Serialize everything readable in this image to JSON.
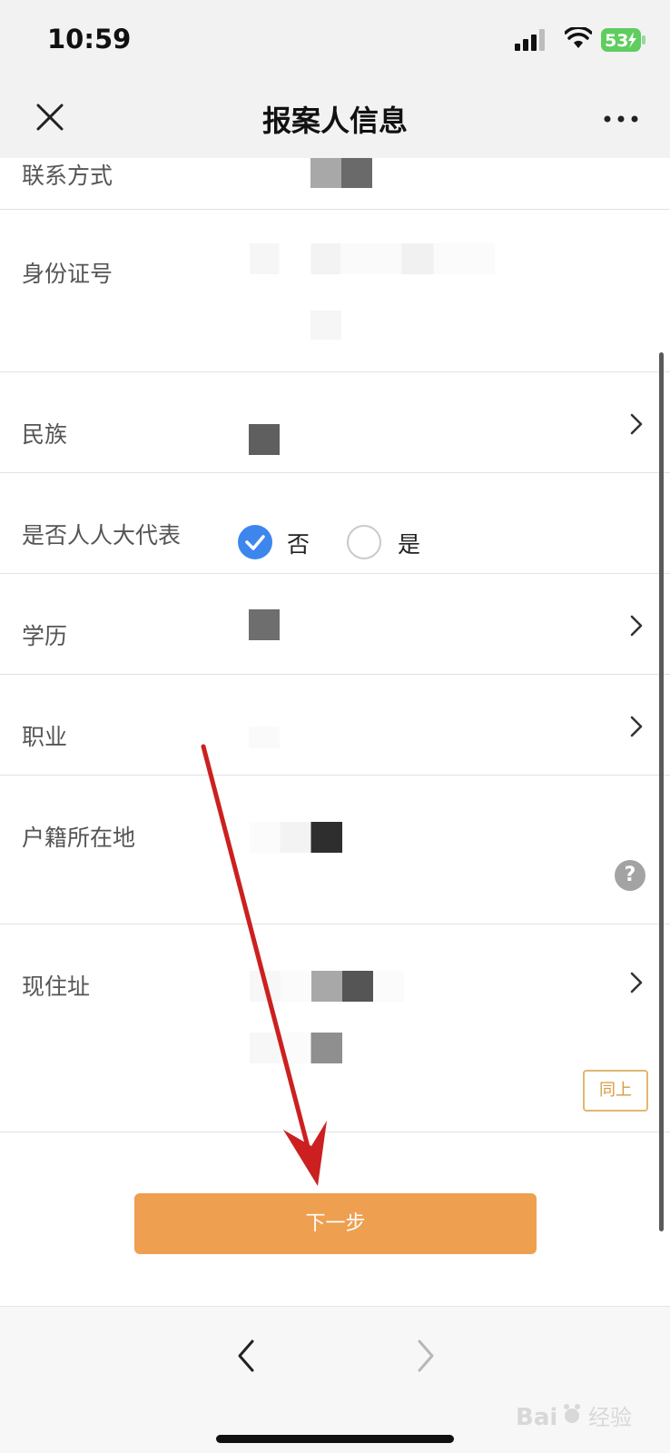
{
  "status": {
    "time": "10:59",
    "battery": "53"
  },
  "nav": {
    "title": "报案人信息"
  },
  "form": {
    "contact_label": "联系方式",
    "id_label": "身份证号",
    "ethnicity_label": "民族",
    "npc_label": "是否人人大代表",
    "npc_options": [
      "否",
      "是"
    ],
    "npc_selected": "否",
    "education_label": "学历",
    "occupation_label": "职业",
    "household_label": "户籍所在地",
    "help_symbol": "?",
    "address_label": "现住址",
    "same_as_above": "同上"
  },
  "next_button": "下一步",
  "watermark": {
    "text": "Bai",
    "text2": "经验"
  },
  "colors": {
    "accent": "#ee9f4f",
    "radio_checked": "#3d86ee",
    "annotation_arrow": "#cc2020"
  }
}
